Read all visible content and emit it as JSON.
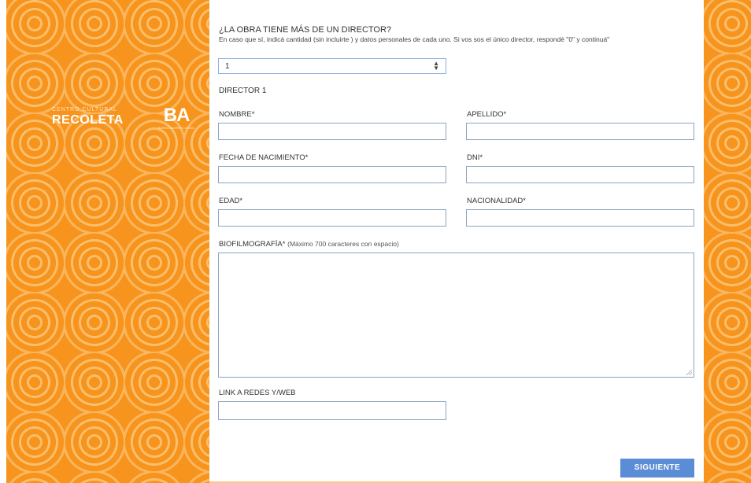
{
  "brand": {
    "ccr_small": "CENTRO CULTURAL",
    "ccr_big": "RECOLETA",
    "ba_logo": "BA",
    "ba_tiny": "BUENOS AIRES CIUDAD"
  },
  "form": {
    "question": "¿LA OBRA TIENE MÁS DE UN DIRECTOR?",
    "hint": "En caso que sí, indicá cantidad (sin incluirte ) y datos personales de cada uno. Si vos sos el único director, respondé \"0\" y continuá\"",
    "director_count": {
      "value": "1",
      "arrows_icon": "up-down-arrows-icon"
    },
    "section_title": "DIRECTOR 1",
    "fields": {
      "nombre": {
        "label": "NOMBRE*",
        "value": ""
      },
      "apellido": {
        "label": "APELLIDO*",
        "value": ""
      },
      "fecha_nacimiento": {
        "label": "FECHA DE NACIMIENTO*",
        "value": ""
      },
      "dni": {
        "label": "DNI*",
        "value": ""
      },
      "edad": {
        "label": "EDAD*",
        "value": ""
      },
      "nacionalidad": {
        "label": "NACIONALIDAD*",
        "value": ""
      },
      "biofilmografia": {
        "label": "BIOFILMOGRAFÍA*",
        "sublabel": "(Máximo 700 caracteres con espacio)",
        "value": ""
      },
      "link": {
        "label": "LINK A REDES Y/WEB",
        "value": ""
      }
    },
    "next_button": "SIGUIENTE"
  },
  "colors": {
    "background_orange": "#f7941d",
    "pattern": "#ffe1aa",
    "button_blue": "#5b8dd6",
    "field_border": "#8da4c0"
  }
}
